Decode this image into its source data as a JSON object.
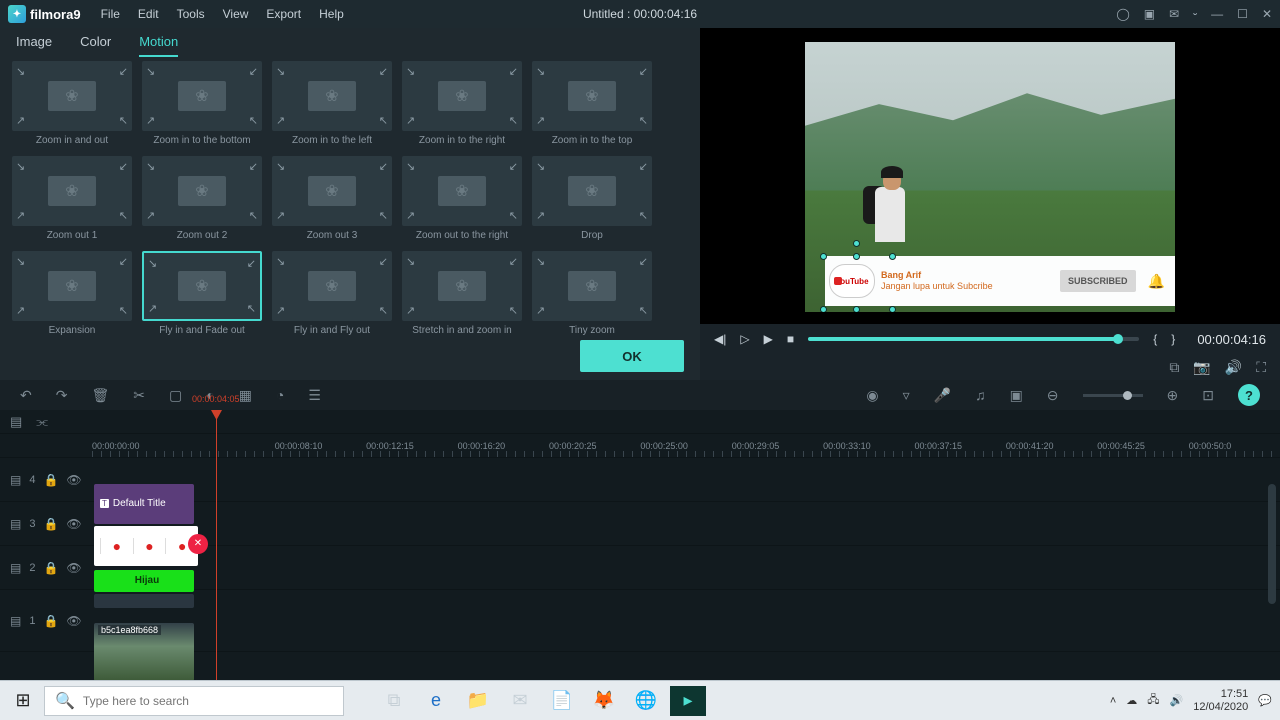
{
  "app": {
    "brand": "filmora9",
    "project_title": "Untitled : 00:00:04:16"
  },
  "menu": {
    "file": "File",
    "edit": "Edit",
    "tools": "Tools",
    "view": "View",
    "export": "Export",
    "help": "Help"
  },
  "tabs": {
    "image": "Image",
    "color": "Color",
    "motion": "Motion"
  },
  "motion": {
    "items": [
      "Zoom in and out",
      "Zoom in to the bottom",
      "Zoom in to the left",
      "Zoom in to the right",
      "Zoom in to the top",
      "Zoom out 1",
      "Zoom out 2",
      "Zoom out 3",
      "Zoom out to the right",
      "Drop",
      "Expansion",
      "Fly in and Fade out",
      "Fly in and Fly out",
      "Stretch in and zoom in",
      "Tiny zoom"
    ],
    "selected_index": 11,
    "ok_label": "OK"
  },
  "preview": {
    "overlay": {
      "name": "Bang Arif",
      "tagline": "Jangan lupa untuk Subcribe",
      "subscribed": "SUBSCRIBED",
      "logo_text": "YouTube"
    },
    "timecode": "00:00:04:16"
  },
  "ruler": {
    "playhead_label": "00:00:04:05",
    "marks": [
      "00:00:00:00",
      "",
      "00:00:08:10",
      "00:00:12:15",
      "00:00:16:20",
      "00:00:20:25",
      "00:00:25:00",
      "00:00:29:05",
      "00:00:33:10",
      "00:00:37:15",
      "00:00:41:20",
      "00:00:45:25",
      "00:00:50:0"
    ]
  },
  "tracks": {
    "t4": {
      "num": "4",
      "clip": "Default Title"
    },
    "t3": {
      "num": "3"
    },
    "t2": {
      "num": "2",
      "green_label": "Hijau"
    },
    "t1": {
      "num": "1",
      "clip": "b5c1ea8fb668"
    }
  },
  "taskbar": {
    "search_placeholder": "Type here to search",
    "time": "17:51",
    "date": "12/04/2020"
  }
}
